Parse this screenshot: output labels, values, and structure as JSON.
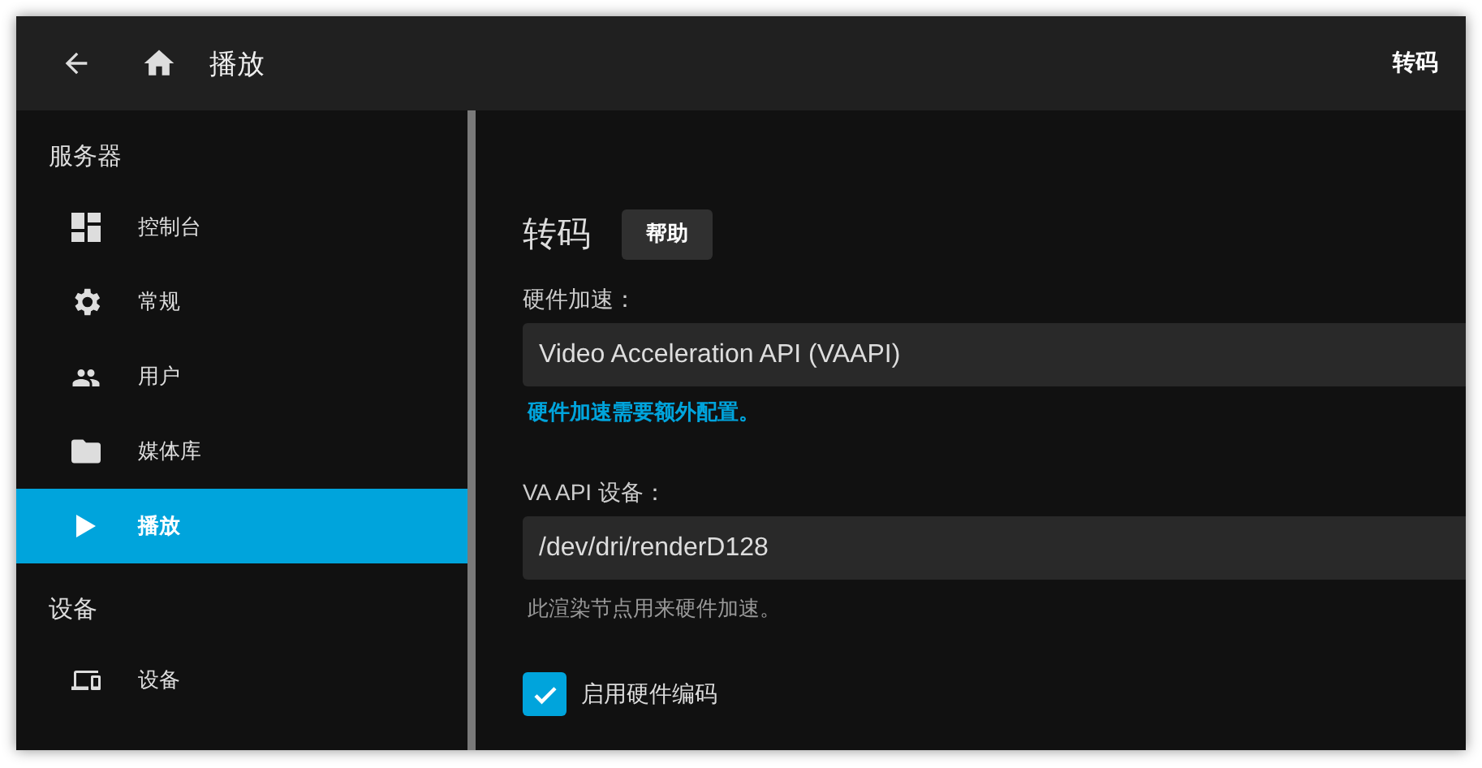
{
  "header": {
    "title": "播放",
    "right_title": "转码"
  },
  "sidebar": {
    "sections": [
      {
        "heading": "服务器",
        "items": [
          {
            "label": "控制台",
            "selected": false
          },
          {
            "label": "常规",
            "selected": false
          },
          {
            "label": "用户",
            "selected": false
          },
          {
            "label": "媒体库",
            "selected": false
          },
          {
            "label": "播放",
            "selected": true
          }
        ]
      },
      {
        "heading": "设备",
        "items": [
          {
            "label": "设备",
            "selected": false
          }
        ]
      }
    ]
  },
  "content": {
    "title": "转码",
    "help_button": "帮助",
    "fields": [
      {
        "kind": "select",
        "label": "硬件加速：",
        "value": "Video Acceleration API (VAAPI)",
        "link": "硬件加速需要额外配置。"
      },
      {
        "kind": "text",
        "label": "VA API 设备：",
        "value": "/dev/dri/renderD128",
        "help": "此渲染节点用来硬件加速。"
      },
      {
        "kind": "checkbox",
        "label": "启用硬件编码",
        "checked": true
      }
    ]
  }
}
